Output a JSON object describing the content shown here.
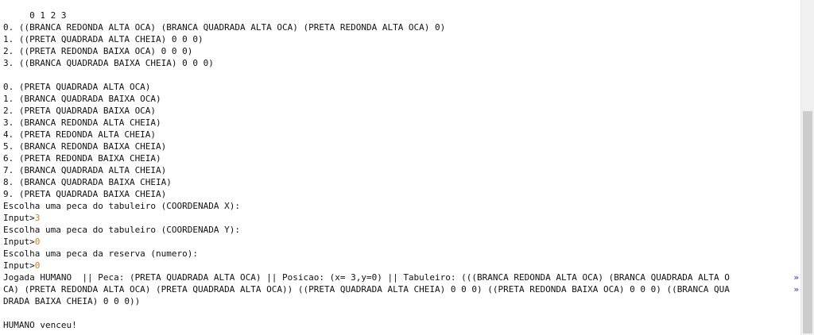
{
  "console": {
    "lines": [
      "     0 1 2 3",
      "0. ((BRANCA REDONDA ALTA OCA) (BRANCA QUADRADA ALTA OCA) (PRETA REDONDA ALTA OCA) 0)",
      "1. ((PRETA QUADRADA ALTA CHEIA) 0 0 0)",
      "2. ((PRETA REDONDA BAIXA OCA) 0 0 0)",
      "3. ((BRANCA QUADRADA BAIXA CHEIA) 0 0 0)",
      "",
      "0. (PRETA QUADRADA ALTA OCA)",
      "1. (BRANCA QUADRADA BAIXA OCA)",
      "2. (PRETA QUADRADA BAIXA OCA)",
      "3. (BRANCA REDONDA ALTA CHEIA)",
      "4. (PRETA REDONDA ALTA CHEIA)",
      "5. (BRANCA REDONDA BAIXA CHEIA)",
      "6. (PRETA REDONDA BAIXA CHEIA)",
      "7. (BRANCA QUADRADA ALTA CHEIA)",
      "8. (BRANCA QUADRADA BAIXA CHEIA)",
      "9. (PRETA QUADRADA BAIXA CHEIA)",
      "Escolha uma peca do tabuleiro (COORDENADA X):",
      "Input>",
      "Escolha uma peca do tabuleiro (COORDENADA Y):",
      "Input>",
      "Escolha uma peca da reserva (numero):",
      "Input>",
      "Jogada HUMANO  || Peca: (PRETA QUADRADA ALTA OCA) || Posicao: (x= 3,y=0) || Tabuleiro: (((BRANCA REDONDA ALTA OCA) (BRANCA QUADRADA ALTA O",
      "CA) (PRETA REDONDA ALTA OCA) (PRETA QUADRADA ALTA OCA)) ((PRETA QUADRADA ALTA CHEIA) 0 0 0) ((PRETA REDONDA BAIXA OCA) 0 0 0) ((BRANCA QUA",
      "DRADA BAIXA CHEIA) 0 0 0))",
      "",
      "HUMANO venceu!"
    ],
    "inputs": {
      "x": "3",
      "y": "0",
      "reserva": "0"
    },
    "continuation_marker": "»",
    "colors": {
      "text": "#111111",
      "user_input": "#e0781a",
      "continuation": "#6a4bc2",
      "background": "#ffffff"
    }
  }
}
